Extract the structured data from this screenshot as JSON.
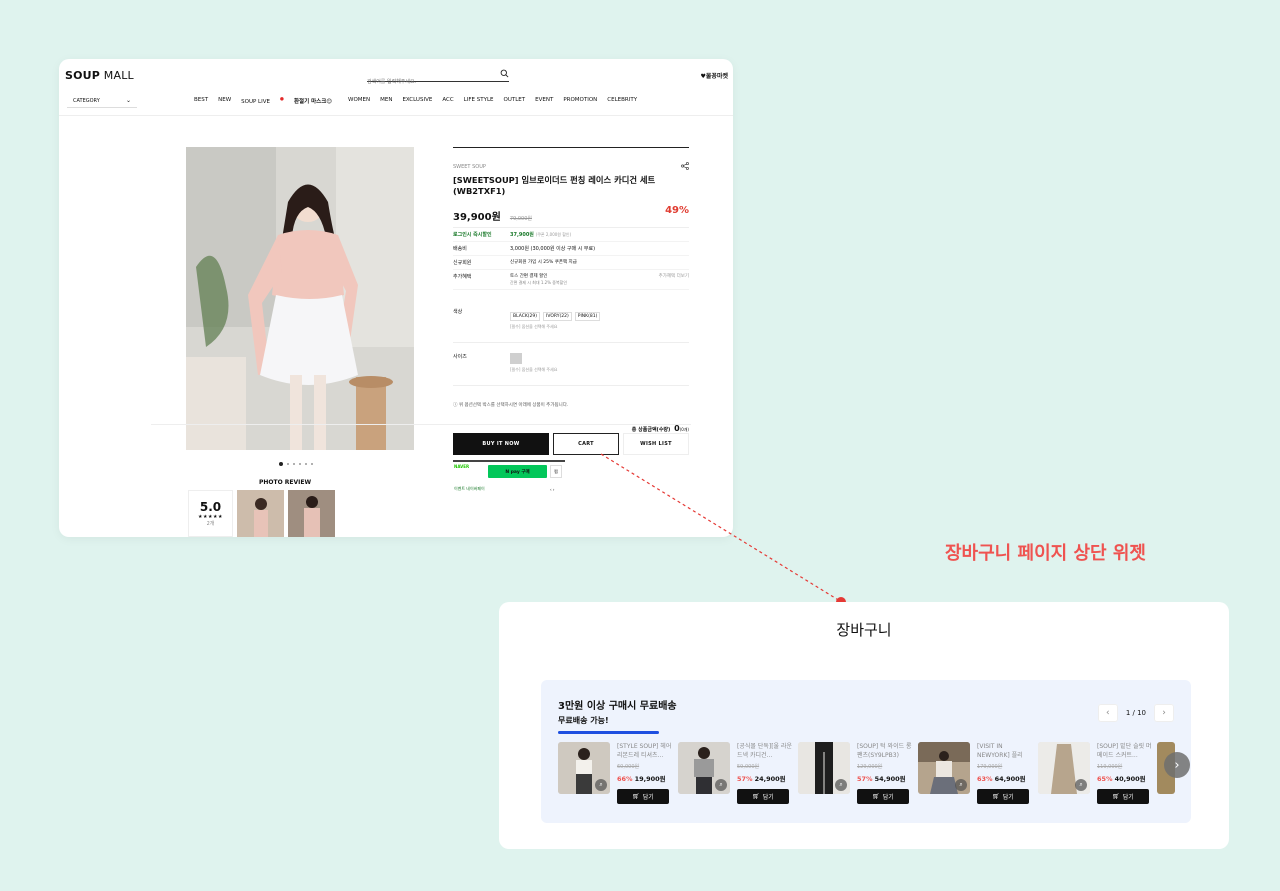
{
  "colors": {
    "background": "#dff3ee",
    "headline": "#ef5350",
    "discount": "#e03c31",
    "progress": "#1e4fe0",
    "naverpay": "#03c75a"
  },
  "header": {
    "logo_bold": "SOUP",
    "logo_light": "MALL",
    "search_placeholder": "검색어를 입력해주세요.",
    "top_right": "♥물꽁마켓",
    "category": "CATEGORY",
    "nav": [
      "BEST",
      "NEW",
      "SOUP LIVE",
      "환절기 마스크😊",
      "WOMEN",
      "MEN",
      "EXCLUSIVE",
      "ACC",
      "LIFE STYLE",
      "OUTLET",
      "EVENT",
      "PROMOTION",
      "CELEBRITY"
    ],
    "nav_live_dot": "●"
  },
  "gallery": {
    "photo_review_title": "PHOTO REVIEW",
    "score": "5.0",
    "stars": "★★★★★",
    "review_count": "2개"
  },
  "product": {
    "brand": "SWEET SOUP",
    "title": "[SWEETSOUP] 임브로이더드 펀칭 레이스 카디건 세트(WB2TXF1)",
    "price": "39,900원",
    "original_price": "79,000원",
    "discount": "49%",
    "specs": [
      {
        "key": "로그인시 즉시할인",
        "value": "37,900원",
        "note": "(쿠폰 2,000원 할인)"
      },
      {
        "key": "배송비",
        "value": "3,000원 (30,000원 이상 구매 시 무료)"
      },
      {
        "key": "신규회원",
        "value": "신규회원 가입 시 25% 쿠폰팩 지급"
      },
      {
        "key": "추가혜택",
        "value": "토스 간편 결제 할인",
        "sub": "간편 결제 시 최대 1.2% 중복할인",
        "extra": "추가혜택 더보기"
      }
    ],
    "color_label": "색상",
    "colors_opts": [
      "BLACK(29)",
      "IVORY(22)",
      "PINK(81)"
    ],
    "color_hint": "[필수] 옵션을 선택해 주세요",
    "size_label": "사이즈",
    "size_hint": "[필수] 옵션을 선택해 주세요",
    "notice": "위 옵션선택 박스를 선택하시면 아래에 상품이 추가됩니다.",
    "total_label": "총 상품금액(수량)",
    "total_value": "0",
    "total_unit": "(0개)",
    "buy_label": "BUY IT NOW",
    "cart_label": "CART",
    "wish_label": "WISH LIST",
    "npay_label": "NAVER",
    "npay_btn": "N pay 구매",
    "npay_side": "찜",
    "npay_foot": "이벤트 네이버페이"
  },
  "annotation": {
    "headline": "장바구니 페이지 상단 위젯"
  },
  "cart": {
    "title": "장바구니",
    "widget_title": "3만원 이상 구매시 무료배송",
    "widget_sub": "무료배송 가능!",
    "progress": 1.0,
    "pager": "1 / 10",
    "products": [
      {
        "name": "[STYLE SOUP] 헤어 리본드레 티셔츠...",
        "orig": "60,000원",
        "pct": "66%",
        "price": "19,900원",
        "btn": "담기"
      },
      {
        "name": "[공식몰 단독][울 라운드넥 카디건...",
        "orig": "59,000원",
        "pct": "57%",
        "price": "24,900원",
        "btn": "담기"
      },
      {
        "name": "[SOUP] 턱 와이드 롱 팬츠(SY9LPB3)",
        "orig": "129,000원",
        "pct": "57%",
        "price": "54,900원",
        "btn": "담기"
      },
      {
        "name": "[VISIT IN NEWYORK] 플리츠...",
        "orig": "179,000원",
        "pct": "63%",
        "price": "64,900원",
        "btn": "담기"
      },
      {
        "name": "[SOUP] 밑단 슬릿 머메이드 스커트...",
        "orig": "119,000원",
        "pct": "65%",
        "price": "40,900원",
        "btn": "담기"
      }
    ]
  }
}
